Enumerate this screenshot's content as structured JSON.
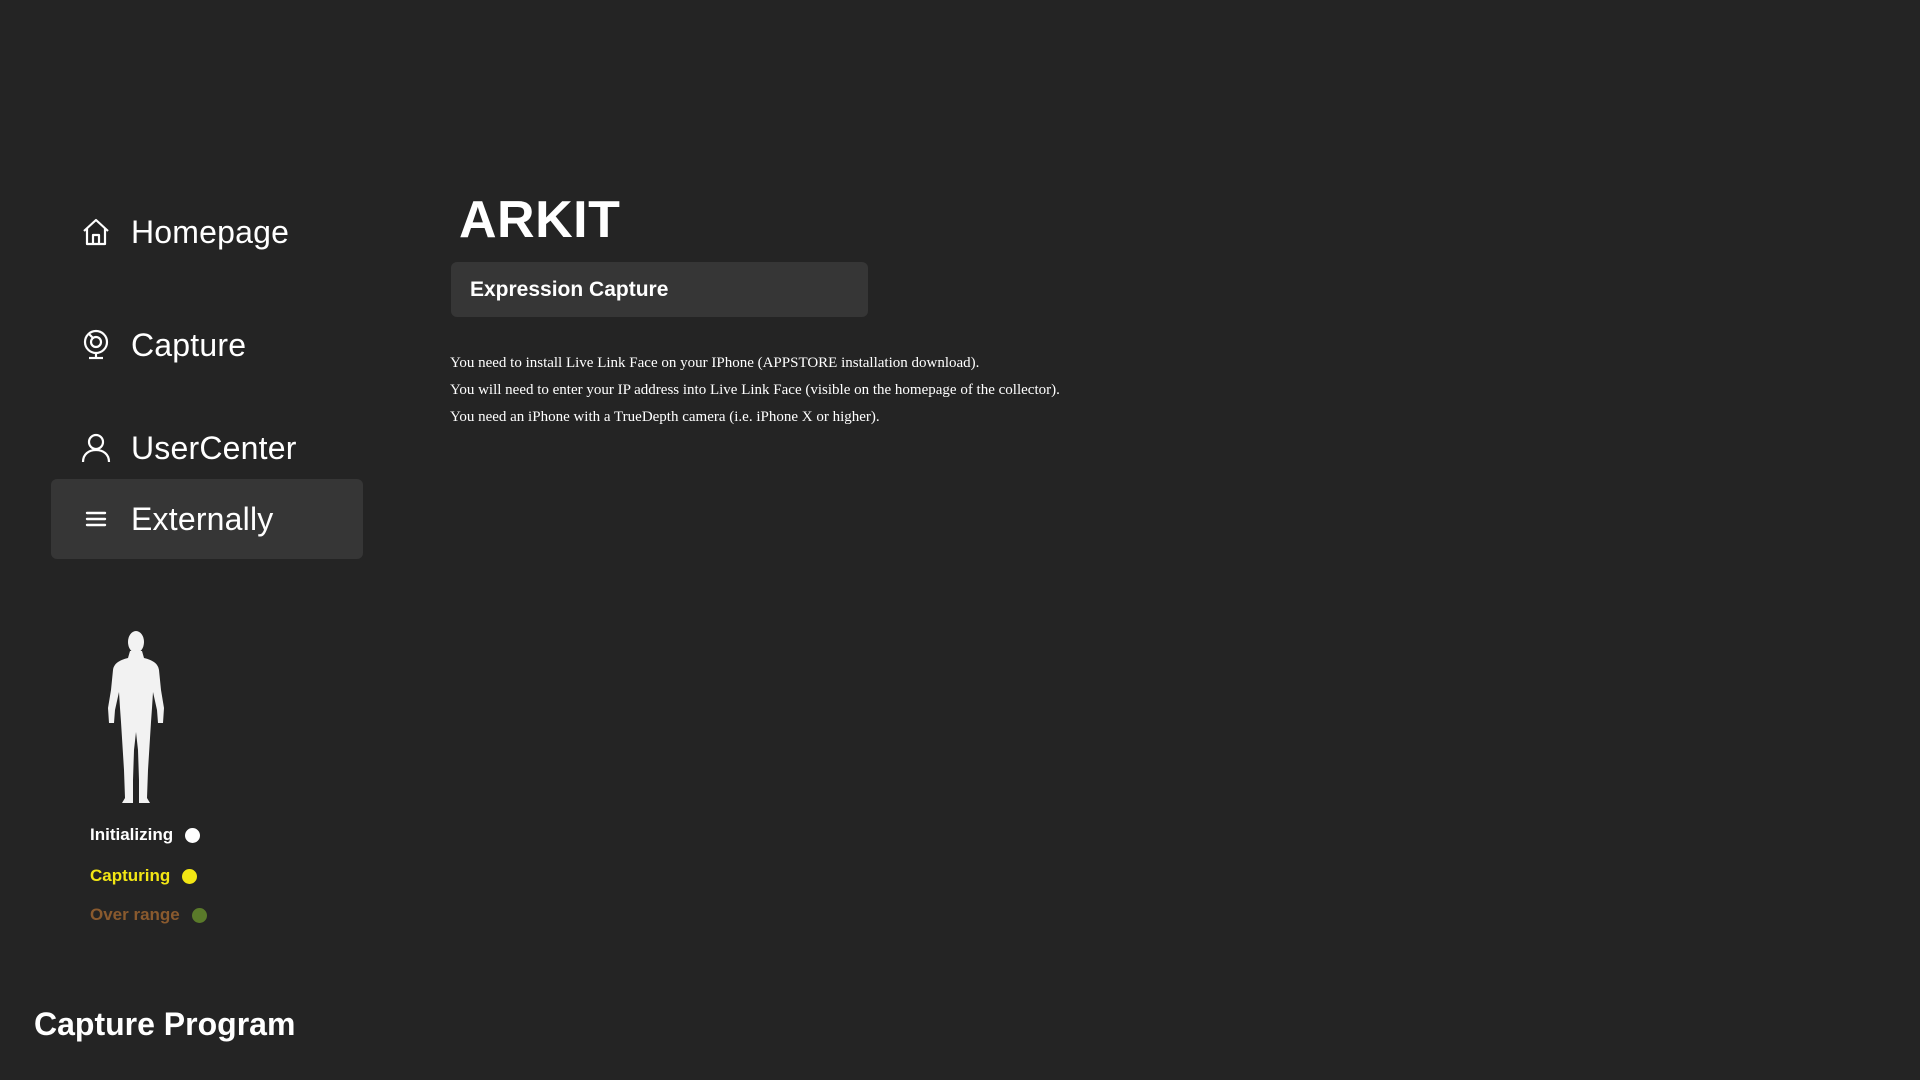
{
  "sidebar": {
    "nav": [
      {
        "label": "Homepage",
        "icon": "home-icon"
      },
      {
        "label": "Capture",
        "icon": "capture-icon"
      },
      {
        "label": "UserCenter",
        "icon": "user-icon"
      },
      {
        "label": "Externally",
        "icon": "menu-icon",
        "active": true
      }
    ],
    "figure_icon": "human-body-icon",
    "status": [
      {
        "label": "Initializing",
        "color": "#ffffff",
        "dot_color": "#ffffff"
      },
      {
        "label": "Capturing",
        "color": "#f2e614",
        "dot_color": "#f2e614"
      },
      {
        "label": "Over range",
        "color": "#8a5a2e",
        "dot_color": "#5a7a2a"
      }
    ],
    "program_title": "Capture Program"
  },
  "main": {
    "title": "ARKIT",
    "tab_label": "Expression Capture",
    "instructions": [
      "You need to install Live Link Face on your IPhone (APPSTORE installation download).",
      "You will need to enter your IP address into Live Link Face (visible on the homepage of the collector).",
      "You need an iPhone with a TrueDepth camera (i.e. iPhone X or higher)."
    ]
  },
  "colors": {
    "background": "#242424",
    "panel": "#363636"
  }
}
